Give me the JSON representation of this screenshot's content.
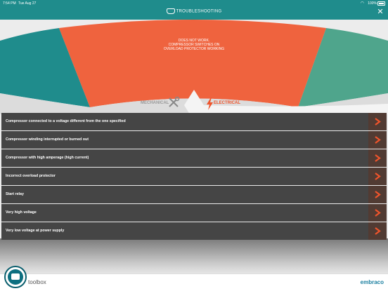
{
  "status_bar": {
    "time": "7:54 PM",
    "date": "Tue Aug 27",
    "battery": "100%"
  },
  "header": {
    "title": "TROUBLESHOOTING"
  },
  "arc": {
    "title_lines": [
      "DOES NOT WORK.",
      "COMPRESSOR SWITCHES ON",
      "OVERLOAD PROTECTOR WORKING"
    ],
    "tabs": {
      "mechanical": "MECHANICAL",
      "electrical": "ELECTRICAL"
    }
  },
  "causes": [
    "Compressor connected to a voltage different from the one specified",
    "Compressor winding interrupted or burned out",
    "Compressor with high amperage (high current)",
    "Incorrect overload protector",
    "Start relay",
    "Very high voltage",
    "Very low voltage at power supply"
  ],
  "footer": {
    "app_name": "toolbox",
    "brand": "embraco"
  },
  "colors": {
    "accent": "#1f8c8c",
    "orange": "#f0542b",
    "row": "#454545"
  }
}
